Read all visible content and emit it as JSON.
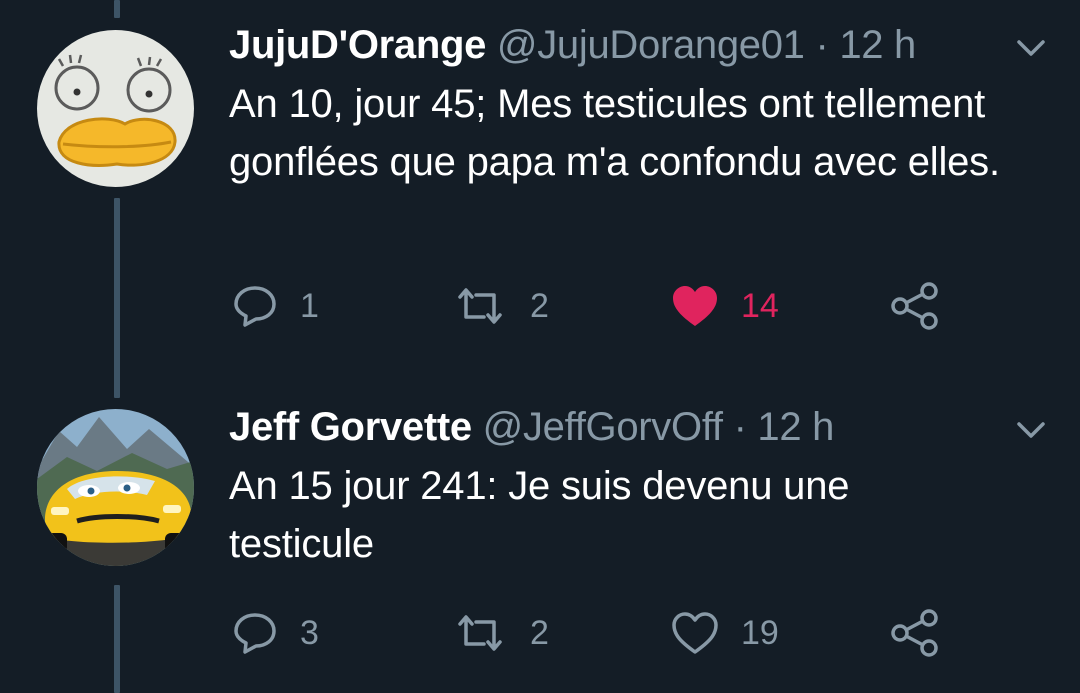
{
  "colors": {
    "background": "#141d26",
    "text_primary": "#ffffff",
    "text_secondary": "#8899a6",
    "thread_line": "#3d5466",
    "like_active": "#e0245e"
  },
  "tweets": [
    {
      "display_name": "JujuD'Orange",
      "handle": "@JujuDorange01",
      "separator": "·",
      "time": "12 h",
      "text": "An 10, jour 45; Mes testicules ont tellement gonflées que papa m'a confondu avec elles.",
      "avatar": "elizabeth-duck-avatar",
      "replies": "1",
      "retweets": "2",
      "likes": "14",
      "liked": true
    },
    {
      "display_name": "Jeff Gorvette",
      "handle": "@JeffGorvOff",
      "separator": "·",
      "time": "12 h",
      "text": "An 15 jour 241: Je suis devenu une testicule",
      "avatar": "yellow-race-car-avatar",
      "replies": "3",
      "retweets": "2",
      "likes": "19",
      "liked": false
    }
  ],
  "icons": {
    "reply": "reply-icon",
    "retweet": "retweet-icon",
    "like": "heart-icon",
    "share": "share-icon",
    "menu": "chevron-down-icon"
  }
}
